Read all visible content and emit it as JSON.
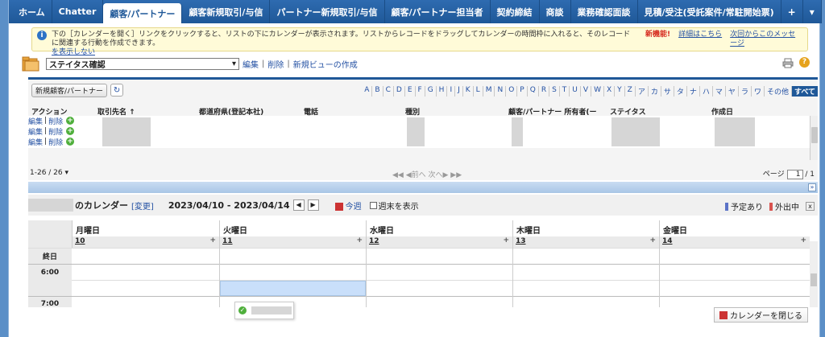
{
  "tabs": [
    {
      "label": "ホーム",
      "active": false
    },
    {
      "label": "Chatter",
      "active": false
    },
    {
      "label": "顧客/パートナー",
      "active": true
    },
    {
      "label": "顧客新規取引/与信",
      "active": false
    },
    {
      "label": "パートナー新規取引/与信",
      "active": false
    },
    {
      "label": "顧客/パートナー担当者",
      "active": false
    },
    {
      "label": "契約締結",
      "active": false
    },
    {
      "label": "商談",
      "active": false
    },
    {
      "label": "業務確認面談",
      "active": false
    },
    {
      "label": "見積/受注(受託案件/常駐開始票)",
      "active": false
    },
    {
      "label": "+",
      "active": false
    },
    {
      "label": "▾",
      "active": false
    }
  ],
  "info": {
    "icon": "info-icon",
    "text": "下の［カレンダーを開く］リンクをクリックすると、リストの下にカレンダーが表示されます。リストからレコードをドラッグしてカレンダーの時間枠に入れると、そのレコードに関連する行動を作成できます。",
    "text_link": "を表示しない",
    "new_label": "新機能!",
    "details_link": "詳細はこちら",
    "hide_link": "次回からこのメッセージ"
  },
  "view": {
    "selected": "ステイタス確認",
    "edit": "編集",
    "delete": "削除",
    "new_view": "新規ビューの作成",
    "sep": "|"
  },
  "list": {
    "new_button": "新規顧客/パートナー",
    "alphabet": [
      "A",
      "B",
      "C",
      "D",
      "E",
      "F",
      "G",
      "H",
      "I",
      "J",
      "K",
      "L",
      "M",
      "N",
      "O",
      "P",
      "Q",
      "R",
      "S",
      "T",
      "U",
      "V",
      "W",
      "X",
      "Y",
      "Z",
      "ア",
      "カ",
      "サ",
      "タ",
      "ナ",
      "ハ",
      "マ",
      "ヤ",
      "ラ",
      "ワ",
      "その他",
      "すべて"
    ],
    "alphabet_selected": "すべて",
    "columns": [
      "アクション",
      "取引先名 ↑",
      "都道府県(登記本社)",
      "電話",
      "種別",
      "顧客/パートナー 所有者(ー",
      "ステイタス",
      "作成日"
    ],
    "rows": [
      {
        "edit": "編集",
        "sep": "|",
        "delete": "削除",
        "add": "+"
      },
      {
        "edit": "編集",
        "sep": "|",
        "delete": "削除",
        "add": "+"
      },
      {
        "edit": "編集",
        "sep": "|",
        "delete": "削除",
        "add": "+"
      }
    ],
    "count": "1-26 / 26 ▾",
    "nav": "◀◀ ◀前へ  次へ▶ ▶▶",
    "page_label": "ページ",
    "page_value": "1",
    "page_total": "/ 1"
  },
  "calendar": {
    "title": "のカレンダー",
    "change": "[変更]",
    "range": "2023/04/10 - 2023/04/14",
    "prev": "◀",
    "next": "▶",
    "today": "今週",
    "weekend": "週末を表示",
    "legend_busy": "予定あり",
    "legend_out": "外出中",
    "legend_busy_color": "#5b73c7",
    "legend_out_color": "#d9534f",
    "close_x": "x",
    "allday": "終日",
    "days": [
      {
        "name": "月曜日",
        "date": "10"
      },
      {
        "name": "火曜日",
        "date": "11"
      },
      {
        "name": "水曜日",
        "date": "12"
      },
      {
        "name": "木曜日",
        "date": "13"
      },
      {
        "name": "金曜日",
        "date": "14"
      }
    ],
    "add": "+",
    "times": [
      "6:00",
      "7:00"
    ],
    "close_button": "カレンダーを閉じる"
  }
}
